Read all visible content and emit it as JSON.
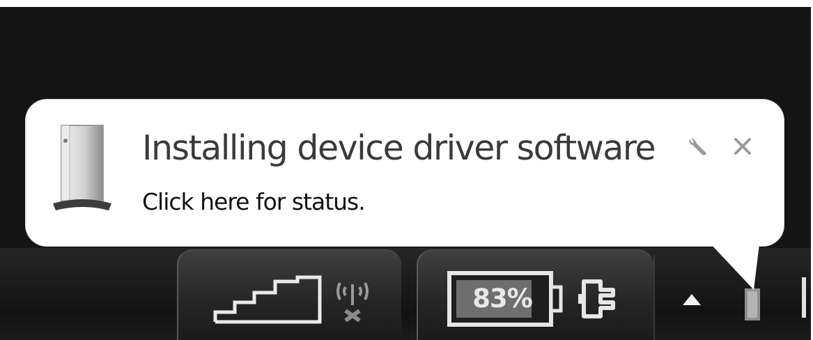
{
  "notification": {
    "title": "Installing device driver software",
    "message": "Click here for status.",
    "icon": "drive-icon",
    "options_icon": "wrench-icon",
    "close_icon": "close-icon"
  },
  "tray": {
    "network_icon": "signal-bars-icon",
    "wireless_icon": "wireless-icon",
    "battery": {
      "label": "83%",
      "level": 0.83,
      "icon": "battery-icon"
    },
    "power_icon": "plug-icon",
    "overflow_icon": "show-hidden-icons-arrow"
  },
  "colors": {
    "taskbar": "#1b1b1b",
    "balloon_bg": "#ffffff",
    "title_text": "#3a3a3a",
    "body_text": "#111111"
  }
}
